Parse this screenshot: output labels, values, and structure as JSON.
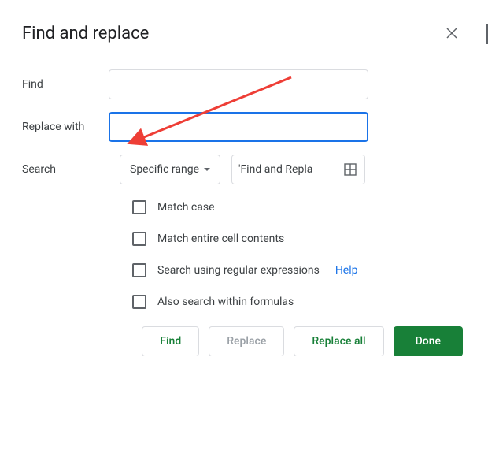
{
  "header": {
    "title": "Find and replace"
  },
  "labels": {
    "find": "Find",
    "replace_with": "Replace with",
    "search": "Search"
  },
  "inputs": {
    "find_value": "",
    "replace_value": ""
  },
  "search": {
    "dropdown_label": "Specific range",
    "range_text": "'Find and Repla"
  },
  "checkboxes": [
    {
      "label": "Match case"
    },
    {
      "label": "Match entire cell contents"
    },
    {
      "label": "Search using regular expressions",
      "help": "Help"
    },
    {
      "label": "Also search within formulas"
    }
  ],
  "buttons": {
    "find": "Find",
    "replace": "Replace",
    "replace_all": "Replace all",
    "done": "Done"
  },
  "colors": {
    "primary_green": "#188038",
    "focus_blue": "#1a73e8",
    "arrow_red": "#ee3e36"
  }
}
